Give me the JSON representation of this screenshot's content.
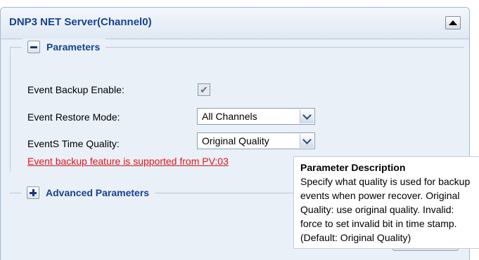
{
  "panel": {
    "title": "DNP3 NET Server(Channel0)"
  },
  "parameters": {
    "title": "Parameters",
    "event_backup_label": "Event Backup Enable:",
    "event_backup_checked": true,
    "event_restore_label": "Event Restore Mode:",
    "event_restore_value": "All Channels",
    "time_quality_label": "EventS Time Quality:",
    "time_quality_value": "Original Quality",
    "warning_link": "Event backup feature is supported from PV:03"
  },
  "advanced": {
    "title": "Advanced Parameters"
  },
  "tooltip": {
    "title": "Parameter Description",
    "lines": [
      "Specify what quality is used for backup",
      "events when power recover. Original",
      "Quality: use original quality. Invalid:",
      "force to set invalid bit in time stamp.",
      "(Default: Original Quality)"
    ]
  },
  "icons": {
    "collapse_panel": "triangle-up-icon",
    "collapse_group": "minus-icon",
    "expand_group": "plus-icon",
    "dropdown": "chevron-down-icon"
  },
  "colors": {
    "title_blue": "#17428f",
    "panel_bg": "#e9f0f8",
    "warning_red": "#e0141b"
  }
}
